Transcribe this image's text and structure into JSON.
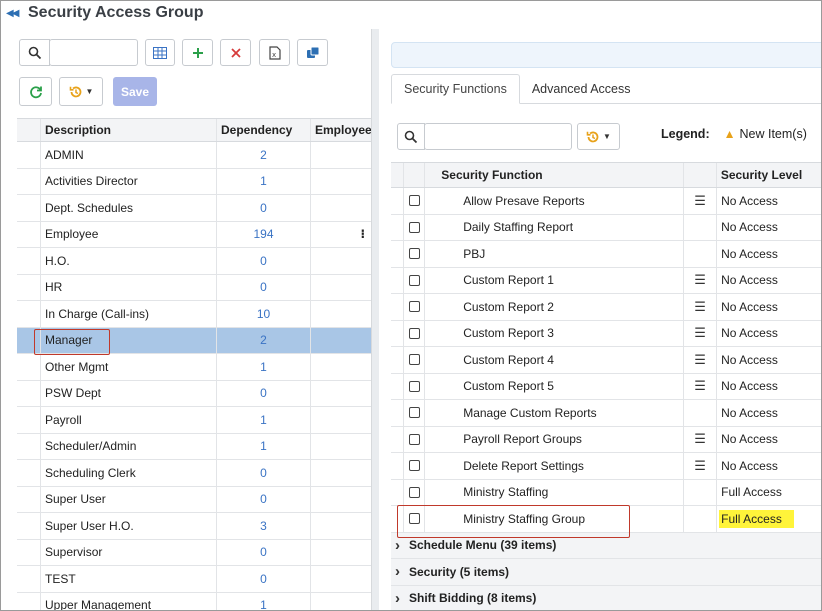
{
  "window": {
    "title": "Security Access Group"
  },
  "left": {
    "search": {
      "placeholder": ""
    },
    "save_label": "Save",
    "columns": {
      "description": "Description",
      "dependency": "Dependency",
      "employee": "Employee"
    },
    "rows": [
      {
        "description": "ADMIN",
        "dependency": "2"
      },
      {
        "description": "Activities Director",
        "dependency": "1"
      },
      {
        "description": "Dept. Schedules",
        "dependency": "0"
      },
      {
        "description": "Employee",
        "dependency": "194"
      },
      {
        "description": "H.O.",
        "dependency": "0"
      },
      {
        "description": "HR",
        "dependency": "0"
      },
      {
        "description": "In Charge (Call-ins)",
        "dependency": "10"
      },
      {
        "description": "Manager",
        "dependency": "2"
      },
      {
        "description": "Other Mgmt",
        "dependency": "1"
      },
      {
        "description": "PSW Dept",
        "dependency": "0"
      },
      {
        "description": "Payroll",
        "dependency": "1"
      },
      {
        "description": "Scheduler/Admin",
        "dependency": "1"
      },
      {
        "description": "Scheduling Clerk",
        "dependency": "0"
      },
      {
        "description": "Super User",
        "dependency": "0"
      },
      {
        "description": "Super User H.O.",
        "dependency": "3"
      },
      {
        "description": "Supervisor",
        "dependency": "0"
      },
      {
        "description": "TEST",
        "dependency": "0"
      },
      {
        "description": "Upper Management",
        "dependency": "1"
      }
    ],
    "selected_row": "Manager"
  },
  "right": {
    "tabs": [
      "Security Functions",
      "Advanced Access"
    ],
    "legend": {
      "label": "Legend:",
      "new_item": "New Item(s)"
    },
    "search": {
      "placeholder": ""
    },
    "columns": {
      "function": "Security Function",
      "level": "Security Level"
    },
    "rows": [
      {
        "name": "Allow Presave Reports",
        "has_list_icon": true,
        "level": "No Access"
      },
      {
        "name": "Daily Staffing Report",
        "has_list_icon": false,
        "level": "No Access"
      },
      {
        "name": "PBJ",
        "has_list_icon": false,
        "level": "No Access"
      },
      {
        "name": "Custom Report 1",
        "has_list_icon": true,
        "level": "No Access"
      },
      {
        "name": "Custom Report 2",
        "has_list_icon": true,
        "level": "No Access"
      },
      {
        "name": "Custom Report 3",
        "has_list_icon": true,
        "level": "No Access"
      },
      {
        "name": "Custom Report 4",
        "has_list_icon": true,
        "level": "No Access"
      },
      {
        "name": "Custom Report 5",
        "has_list_icon": true,
        "level": "No Access"
      },
      {
        "name": "Manage Custom Reports",
        "has_list_icon": false,
        "level": "No Access"
      },
      {
        "name": "Payroll Report Groups",
        "has_list_icon": true,
        "level": "No Access"
      },
      {
        "name": "Delete Report Settings",
        "has_list_icon": true,
        "level": "No Access"
      },
      {
        "name": "Ministry Staffing",
        "has_list_icon": false,
        "level": "Full Access"
      },
      {
        "name": "Ministry Staffing Group",
        "has_list_icon": false,
        "level": "Full Access",
        "highlighted": true
      }
    ],
    "groups": [
      {
        "label": "Schedule Menu (39 items)"
      },
      {
        "label": "Security (5 items)"
      },
      {
        "label": "Shift Bidding (8 items)"
      }
    ]
  },
  "colors": {
    "accent": "#2d6fb3",
    "selected_row": "#a9c6e6",
    "highlight": "#fff43a",
    "annotation": "#c0392b",
    "save_button": "#a8b5e8"
  }
}
